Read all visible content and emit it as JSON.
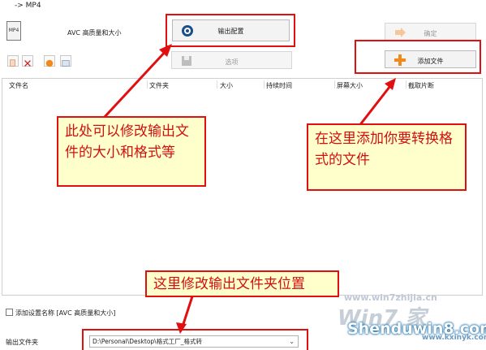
{
  "window": {
    "title": "-> MP4"
  },
  "profile": {
    "icon_text": "MP4",
    "label": "AVC 高质量和大小"
  },
  "buttons": {
    "output_config": "输出配置",
    "options": "选项",
    "confirm": "确定",
    "add_file": "添加文件"
  },
  "file_list": {
    "columns": [
      "文件名",
      "文件夹",
      "大小",
      "持续时间",
      "屏幕大小",
      "截取片断"
    ]
  },
  "callouts": {
    "output_config": "此处可以修改输出文件的大小和格式等",
    "add_file": "在这里添加你要转换格式的文件",
    "output_folder": "这里修改输出文件夹位置"
  },
  "options_row": {
    "add_setting_name": "添加设置名称 [AVC 高质量和大小]"
  },
  "output_folder": {
    "label": "输出文件夹",
    "path": "D:\\Personal\\Desktop\\格式工厂_格式转"
  },
  "watermark": {
    "site1": "www.win7zhijia.cn",
    "logo": "Win7 家",
    "site2": "Shenduwin8.com",
    "site3": "www.kxinyk.com"
  },
  "colors": {
    "annotation_red": "#e01010",
    "callout_bg": "#ffffcc",
    "add_icon": "#f08a1c"
  }
}
